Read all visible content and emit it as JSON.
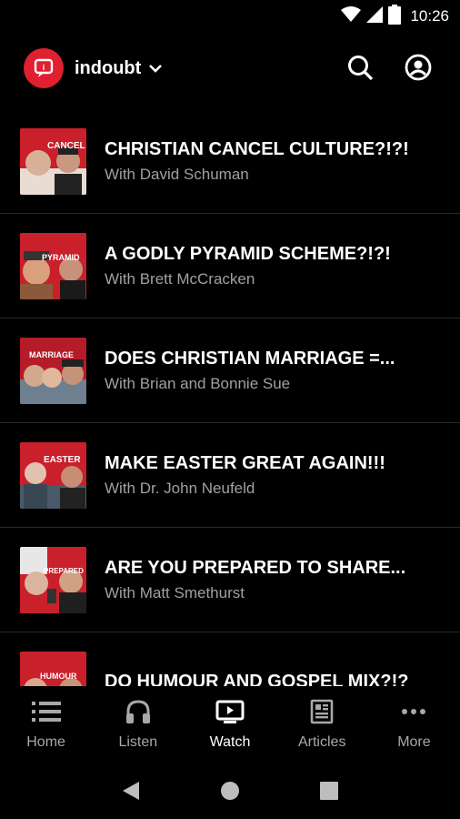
{
  "status_bar": {
    "time": "10:26",
    "icons": [
      "wifi-icon",
      "cellular-signal-icon",
      "battery-icon"
    ]
  },
  "header": {
    "channel_name": "indoubt",
    "logo_icon": "podcast-logo-icon",
    "actions": [
      "search-icon",
      "account-circle-icon"
    ]
  },
  "episodes": [
    {
      "title": "CHRISTIAN CANCEL CULTURE?!?!",
      "subtitle": "With David Schuman",
      "thumb_text": "CANCEL"
    },
    {
      "title": "A GODLY PYRAMID SCHEME?!?!",
      "subtitle": "With Brett McCracken",
      "thumb_text": "PYRAMID"
    },
    {
      "title": "DOES CHRISTIAN MARRIAGE =...",
      "subtitle": "With Brian and Bonnie Sue",
      "thumb_text": "MARRIAGE"
    },
    {
      "title": "MAKE EASTER GREAT AGAIN!!!",
      "subtitle": "With Dr. John Neufeld",
      "thumb_text": "EASTER"
    },
    {
      "title": "ARE YOU PREPARED TO SHARE...",
      "subtitle": "With Matt Smethurst",
      "thumb_text": "PREPARED"
    },
    {
      "title": "DO HUMOUR AND GOSPEL MIX?!?",
      "subtitle": "",
      "thumb_text": "HUMOUR"
    }
  ],
  "bottom_nav": [
    {
      "label": "Home",
      "icon": "list-icon",
      "active": false
    },
    {
      "label": "Listen",
      "icon": "headphones-icon",
      "active": false
    },
    {
      "label": "Watch",
      "icon": "video-screen-icon",
      "active": true
    },
    {
      "label": "Articles",
      "icon": "newspaper-icon",
      "active": false
    },
    {
      "label": "More",
      "icon": "more-horizontal-icon",
      "active": false
    }
  ],
  "system_nav": [
    "back-icon",
    "home-circle-icon",
    "recents-square-icon"
  ],
  "colors": {
    "background": "#000000",
    "brand": "#e0202f",
    "subtitle": "#a0a0a0",
    "divider": "#2a2a2a"
  }
}
